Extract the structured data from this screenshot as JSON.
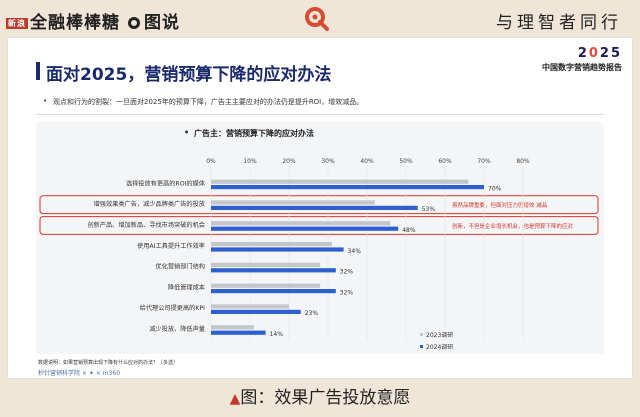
{
  "header": {
    "brand_tag": "新浪",
    "brand_name": "全融棒棒糖",
    "section": "图说",
    "motto": "与理智者同行"
  },
  "slide": {
    "year_prefix": "2",
    "year_mid": "0",
    "year_suffix": "25",
    "report": "中国数字营销趋势报告",
    "title": "面对2025，营销预算下降的应对办法",
    "subtitle": "观点和行为的割裂：一旦面对2025年的预算下降，广告主主要应对的办法仍是提升ROI，增效减品。",
    "note": "数据说明：如果营销预算出现下降有什么应对的办法？（多选）",
    "partners": "秒针营销科学院 × ✦ × m360"
  },
  "chart_data": {
    "type": "bar",
    "orientation": "horizontal",
    "title": "广告主：营销预算下降的应对办法",
    "categories": [
      "选择投放有更高的ROI的媒体",
      "增强效果类广告，减少品牌类广告的投放",
      "创新产品、增加新品、寻找市场突破的机会",
      "使用AI工具提升工作效率",
      "优化营销部门结构",
      "降低管理成本",
      "给代理公司提更高的KPI",
      "减少投放、降低声量"
    ],
    "series": [
      {
        "name": "2023调研",
        "color": "#c4c6cc",
        "values": [
          66,
          42,
          46,
          31,
          28,
          28,
          20,
          11
        ]
      },
      {
        "name": "2024调研",
        "color": "#2d5fd3",
        "values": [
          70,
          53,
          48,
          34,
          32,
          32,
          23,
          14
        ]
      }
    ],
    "value_labels": [
      "70%",
      "53%",
      "48%",
      "34%",
      "32%",
      "32%",
      "23%",
      "14%"
    ],
    "xticks": [
      "0%",
      "10%",
      "20%",
      "30%",
      "40%",
      "50%",
      "60%",
      "70%",
      "80%"
    ],
    "xlim": [
      0,
      80
    ],
    "legend_position": "bottom-right",
    "highlighted_rows": [
      1,
      2
    ],
    "annotations": [
      "虽然品牌重要，但面对压力仍增效 减品",
      "创新，不但是企业增长机会，也是预算下降的应对"
    ]
  },
  "caption": "图：效果广告投放意愿"
}
